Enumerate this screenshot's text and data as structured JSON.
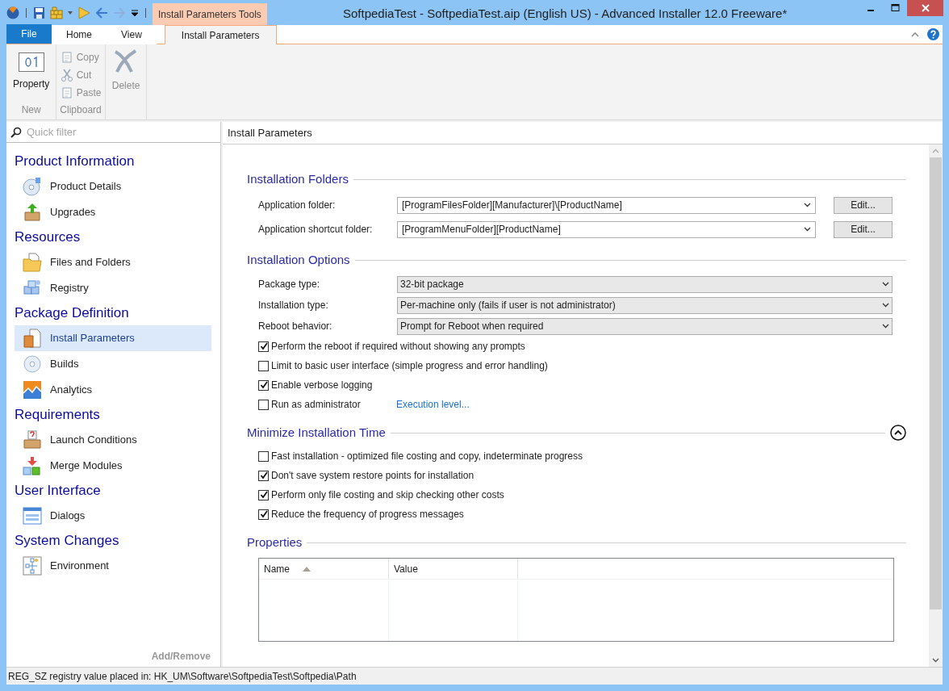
{
  "title_bar": {
    "title": "SoftpediaTest - SoftpediaTest.aip (English US) - Advanced Installer 12.0 Freeware*",
    "context_tab": "Install Parameters Tools"
  },
  "ribbon": {
    "tabs": [
      {
        "label": "File",
        "kind": "file",
        "selected": false
      },
      {
        "label": "Home",
        "kind": "tab",
        "selected": false
      },
      {
        "label": "View",
        "kind": "tab",
        "selected": false
      },
      {
        "label": "Install Parameters",
        "kind": "tab",
        "selected": true
      }
    ],
    "groups": [
      {
        "label": "New",
        "buttons": [
          {
            "label": "Property",
            "kind": "large",
            "disabled": false
          }
        ]
      },
      {
        "label": "Clipboard",
        "buttons": [
          {
            "label": "Copy",
            "kind": "small",
            "disabled": true
          },
          {
            "label": "Cut",
            "kind": "small",
            "disabled": true
          },
          {
            "label": "Paste",
            "kind": "small",
            "disabled": true
          }
        ]
      },
      {
        "buttons": [
          {
            "label": "Delete",
            "kind": "large",
            "disabled": true
          }
        ]
      }
    ]
  },
  "sidebar": {
    "filter_placeholder": "Quick filter",
    "groups": [
      {
        "title": "Product Information",
        "items": [
          {
            "label": "Product Details",
            "selected": false
          },
          {
            "label": "Upgrades",
            "selected": false
          }
        ]
      },
      {
        "title": "Resources",
        "items": [
          {
            "label": "Files and Folders",
            "selected": false
          },
          {
            "label": "Registry",
            "selected": false
          }
        ]
      },
      {
        "title": "Package Definition",
        "items": [
          {
            "label": "Install Parameters",
            "selected": true
          },
          {
            "label": "Builds",
            "selected": false
          },
          {
            "label": "Analytics",
            "selected": false
          }
        ]
      },
      {
        "title": "Requirements",
        "items": [
          {
            "label": "Launch Conditions",
            "selected": false
          },
          {
            "label": "Merge Modules",
            "selected": false
          }
        ]
      },
      {
        "title": "User Interface",
        "items": [
          {
            "label": "Dialogs",
            "selected": false
          }
        ]
      },
      {
        "title": "System Changes",
        "items": [
          {
            "label": "Environment",
            "selected": false
          }
        ]
      }
    ],
    "footer": "Add/Remove"
  },
  "main": {
    "header": "Install Parameters",
    "sections": [
      {
        "title": "Installation Folders",
        "items": [
          {
            "kind": "path",
            "label": "Application folder:",
            "value": "[ProgramFilesFolder][Manufacturer]\\[ProductName]",
            "button": "Edit..."
          },
          {
            "kind": "path",
            "label": "Application shortcut folder:",
            "value": "[ProgramMenuFolder][ProductName]",
            "button": "Edit..."
          }
        ]
      },
      {
        "title": "Installation Options",
        "items": [
          {
            "kind": "select",
            "label": "Package type:",
            "value": "32-bit package"
          },
          {
            "kind": "select",
            "label": "Installation type:",
            "value": "Per-machine only (fails if user is not administrator)"
          },
          {
            "kind": "select",
            "label": "Reboot behavior:",
            "value": "Prompt for Reboot when required"
          },
          {
            "kind": "checkbox",
            "label": "Perform the reboot if required without showing any prompts",
            "checked": true
          },
          {
            "kind": "checkbox",
            "label": "Limit to basic user interface (simple progress and error handling)",
            "checked": false
          },
          {
            "kind": "checkbox",
            "label": "Enable verbose logging",
            "checked": true
          },
          {
            "kind": "checkbox",
            "label": "Run as administrator",
            "checked": false,
            "link": "Execution level..."
          }
        ]
      },
      {
        "title": "Minimize Installation Time",
        "expanded": true,
        "items": [
          {
            "kind": "checkbox",
            "label": "Fast installation - optimized file costing and copy, indeterminate progress",
            "checked": false
          },
          {
            "kind": "checkbox",
            "label": "Don't save system restore points for installation",
            "checked": true
          },
          {
            "kind": "checkbox",
            "label": "Perform only file costing and skip checking other costs",
            "checked": true
          },
          {
            "kind": "checkbox",
            "label": "Reduce the frequency of progress messages",
            "checked": true
          }
        ]
      },
      {
        "title": "Properties",
        "items": [
          {
            "kind": "table",
            "columns": [
              {
                "label": "Name",
                "sort_ascending": true
              },
              {
                "label": "Value"
              }
            ]
          }
        ]
      }
    ]
  },
  "status_bar": {
    "text": "REG_SZ registry value placed in: HK_UM\\Software\\SoftpediaTest\\Softpedia\\Path"
  }
}
